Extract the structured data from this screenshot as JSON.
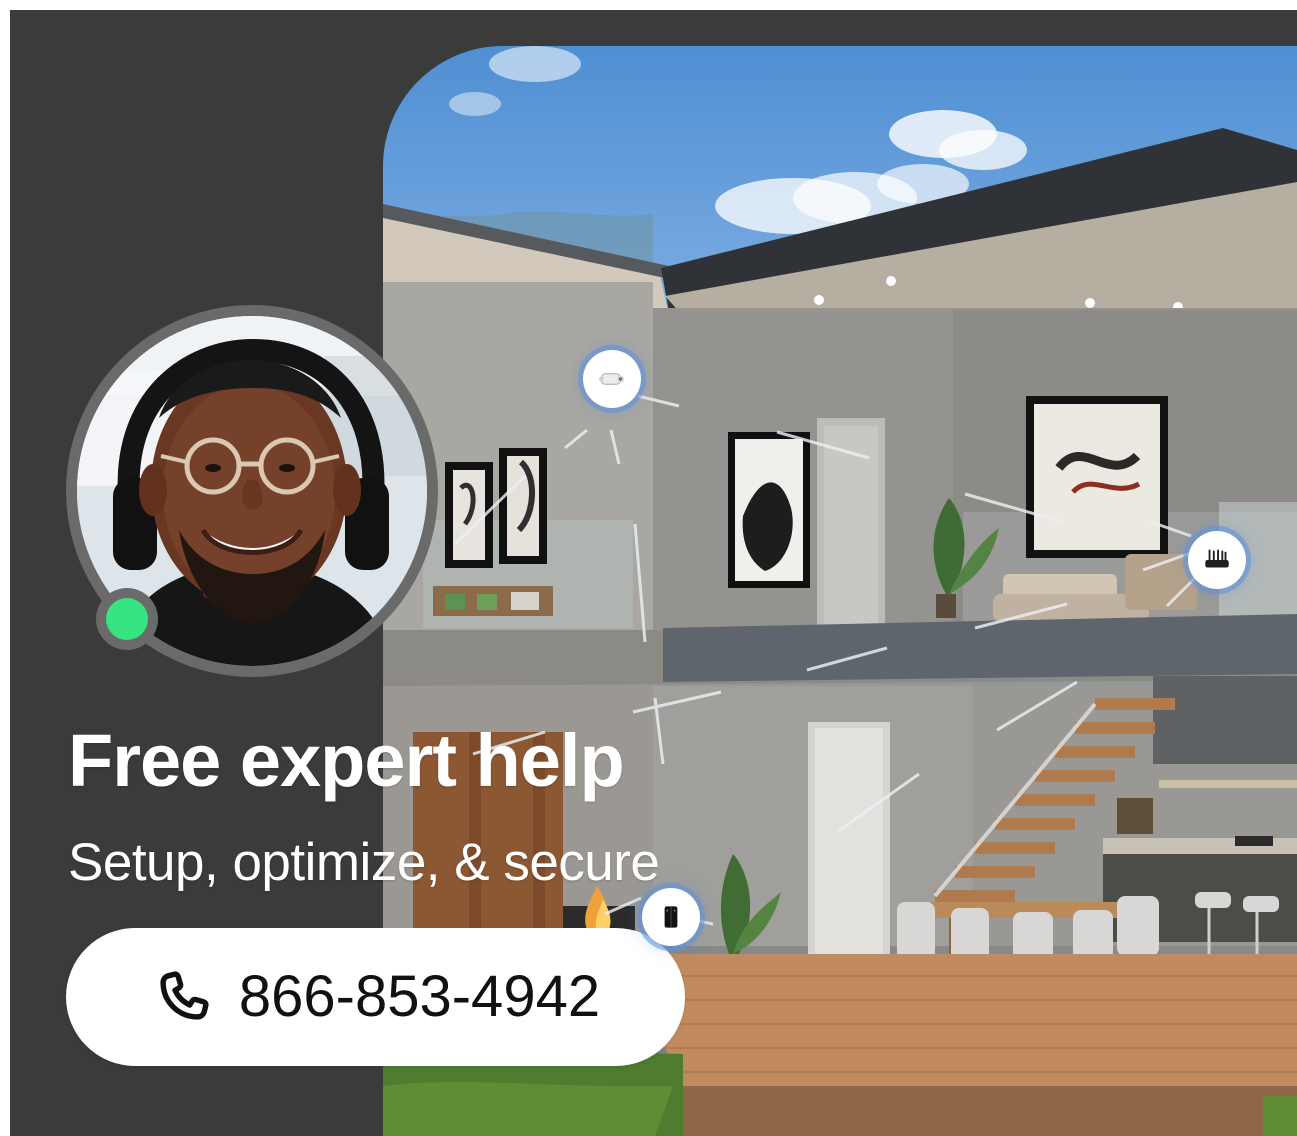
{
  "banner": {
    "headline": "Free expert help",
    "subheadline": "Setup, optimize, & secure",
    "phone": "866-853-4942",
    "status": "online"
  },
  "icons": {
    "phone": "phone-icon",
    "camera": "security-camera-icon",
    "router": "router-icon",
    "mesh": "mesh-wifi-icon",
    "status": "online-status-icon"
  },
  "colors": {
    "background": "#3b3b3b",
    "text": "#ffffff",
    "button_background": "#ffffff",
    "status": "#36e481",
    "hotspot_glow": "#5f91dc"
  }
}
